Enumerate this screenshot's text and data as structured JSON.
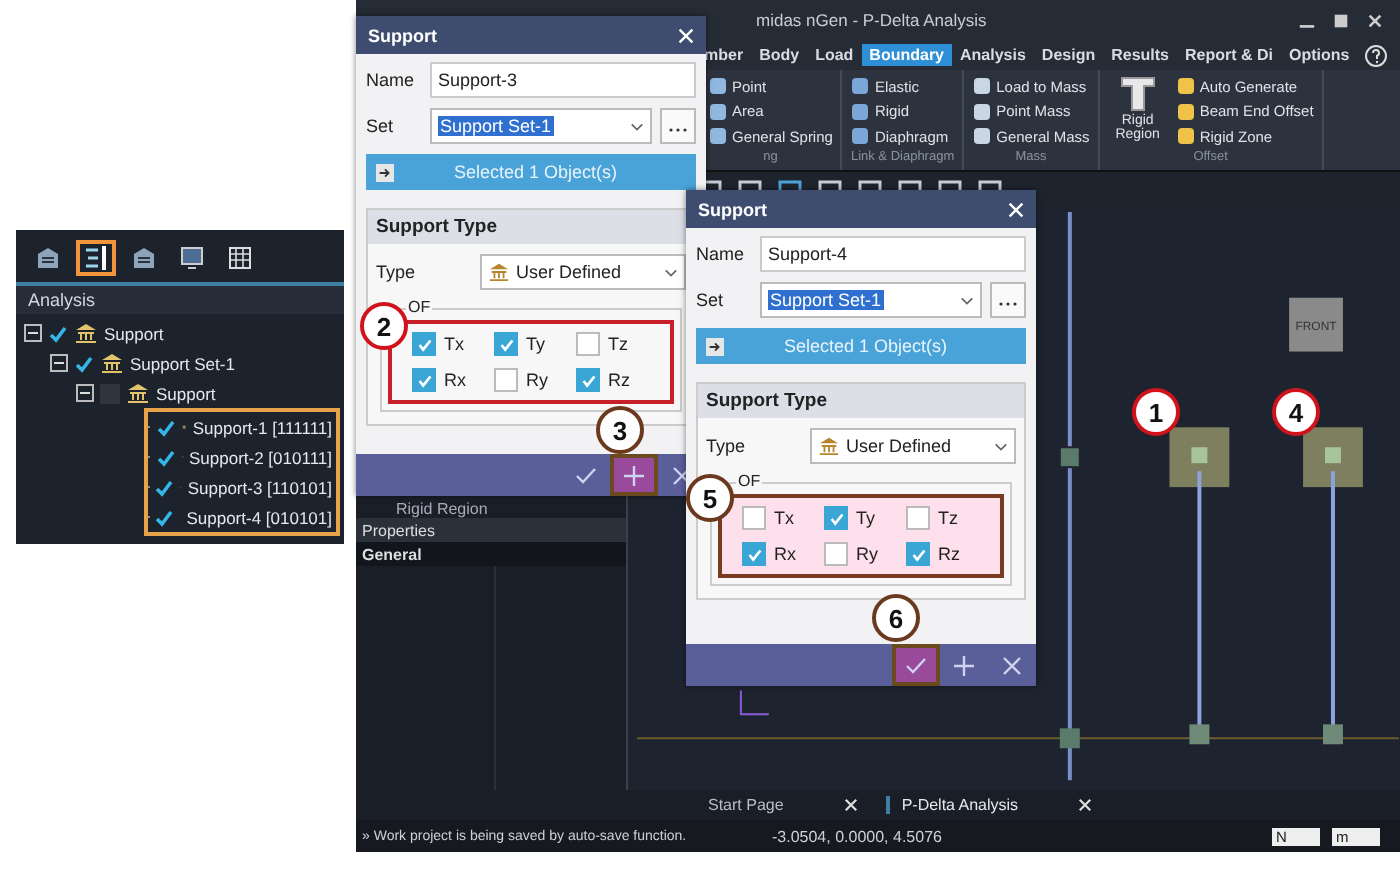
{
  "left_panel": {
    "tabs": [
      {
        "selected": false
      },
      {
        "selected": true
      },
      {
        "selected": false
      },
      {
        "selected": false
      },
      {
        "selected": false
      }
    ],
    "title": "Analysis",
    "tree": [
      {
        "label": "Support",
        "checked": true,
        "expanded": true,
        "children": [
          {
            "label": "Support Set-1",
            "checked": true,
            "expanded": true,
            "children": [
              {
                "label": "Support",
                "checked": false,
                "expanded": true,
                "children": [
                  {
                    "label": "Support-1 [111111]",
                    "checked": true
                  },
                  {
                    "label": "Support-2 [010111]",
                    "checked": true
                  },
                  {
                    "label": "Support-3 [110101]",
                    "checked": true
                  },
                  {
                    "label": "Support-4 [010101]",
                    "checked": true
                  }
                ]
              }
            ]
          }
        ]
      }
    ]
  },
  "app": {
    "title": "midas nGen - P-Delta Analysis",
    "ribbon_tabs": [
      {
        "label": "mber",
        "selected": false
      },
      {
        "label": "Body",
        "selected": false
      },
      {
        "label": "Load",
        "selected": false
      },
      {
        "label": "Boundary",
        "selected": true
      },
      {
        "label": "Analysis",
        "selected": false
      },
      {
        "label": "Design",
        "selected": false
      },
      {
        "label": "Results",
        "selected": false
      },
      {
        "label": "Report & Di",
        "selected": false
      },
      {
        "label": "Options",
        "selected": false
      }
    ],
    "ribbon_groups": [
      {
        "label": "ng",
        "items": [
          {
            "kind": "small",
            "label": "Point"
          },
          {
            "kind": "small",
            "label": "Area"
          },
          {
            "kind": "small",
            "label": "General Spring"
          }
        ]
      },
      {
        "label": "Link & Diaphragm",
        "items": [
          {
            "kind": "small",
            "label": "Elastic"
          },
          {
            "kind": "small",
            "label": "Rigid"
          },
          {
            "kind": "small",
            "label": "Diaphragm"
          }
        ]
      },
      {
        "label": "Mass",
        "items": [
          {
            "kind": "small",
            "label": "Load to Mass"
          },
          {
            "kind": "small",
            "label": "Point Mass"
          },
          {
            "kind": "small",
            "label": "General Mass"
          }
        ]
      },
      {
        "label": "Offset",
        "items": [
          {
            "kind": "large",
            "label": "Rigid Region"
          },
          {
            "kind": "small",
            "label": "Auto Generate"
          },
          {
            "kind": "small",
            "label": "Beam End Offset"
          },
          {
            "kind": "small",
            "label": "Rigid Zone"
          }
        ]
      }
    ],
    "dock_tree_item": "Rigid Region",
    "properties": {
      "title": "Properties",
      "section": "General"
    },
    "view_cube": "FRONT",
    "document_tabs": [
      {
        "label": "Start Page",
        "selected": false
      },
      {
        "label": "P-Delta Analysis",
        "selected": true
      }
    ],
    "status": {
      "message": "» Work project is being saved by auto-save function.",
      "coordinates": "-3.0504, 0.0000, 4.5076",
      "force_unit": "N",
      "length_unit": "m"
    }
  },
  "dialogs": [
    {
      "title": "Support",
      "name_label": "Name",
      "name": "Support-3",
      "set_label": "Set",
      "set": "Support Set-1",
      "select_button": "Selected 1 Object(s)",
      "section": "Support Type",
      "type_label": "Type",
      "type": "User Defined",
      "dof_legend": "OF",
      "dof_fill": false,
      "buttons": [
        {
          "kind": "ok",
          "highlighted": false
        },
        {
          "kind": "add",
          "highlighted": true
        },
        {
          "kind": "cancel",
          "highlighted": false
        }
      ],
      "dof": [
        {
          "label": "Tx",
          "checked": true
        },
        {
          "label": "Ty",
          "checked": true
        },
        {
          "label": "Tz",
          "checked": false
        },
        {
          "label": "Rx",
          "checked": true
        },
        {
          "label": "Ry",
          "checked": false
        },
        {
          "label": "Rz",
          "checked": true
        }
      ]
    },
    {
      "title": "Support",
      "name_label": "Name",
      "name": "Support-4",
      "set_label": "Set",
      "set": "Support Set-1",
      "select_button": "Selected 1 Object(s)",
      "section": "Support Type",
      "type_label": "Type",
      "type": "User Defined",
      "dof_legend": "OF",
      "dof_fill": true,
      "buttons": [
        {
          "kind": "ok",
          "highlighted": true
        },
        {
          "kind": "add",
          "highlighted": false
        },
        {
          "kind": "cancel",
          "highlighted": false
        }
      ],
      "dof": [
        {
          "label": "Tx",
          "checked": false
        },
        {
          "label": "Ty",
          "checked": true
        },
        {
          "label": "Tz",
          "checked": false
        },
        {
          "label": "Rx",
          "checked": true
        },
        {
          "label": "Ry",
          "checked": false
        },
        {
          "label": "Rz",
          "checked": true
        }
      ]
    }
  ],
  "callouts": [
    {
      "label": "1",
      "color": "#d0121b"
    },
    {
      "label": "2",
      "color": "#d0121b"
    },
    {
      "label": "3",
      "color": "#6b3a1e"
    },
    {
      "label": "4",
      "color": "#d0121b"
    },
    {
      "label": "5",
      "color": "#6b3a1e"
    },
    {
      "label": "6",
      "color": "#6b3a1e"
    }
  ]
}
